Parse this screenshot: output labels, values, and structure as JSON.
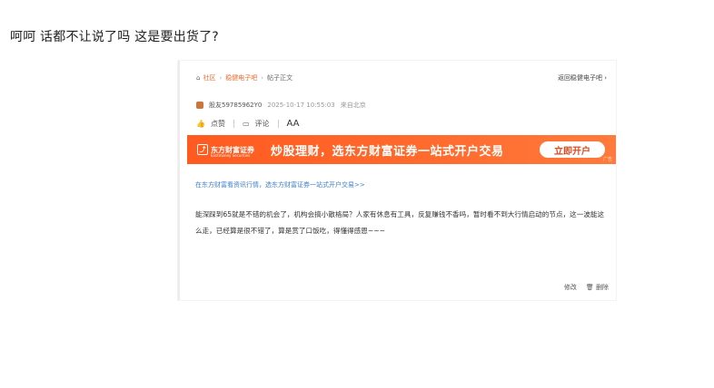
{
  "post": {
    "text": "呵呵 话都不让说了吗 这是要出货了?"
  },
  "screenshot": {
    "breadcrumb": {
      "home": "社区",
      "forum": "稳健电子吧",
      "current": "帖子正文"
    },
    "back_link": "返回稳健电子吧",
    "author": {
      "name": "股友59785962Y0",
      "timestamp": "2025-10-17 10:55:03",
      "location": "来自北京"
    },
    "actions": {
      "like": "点赞",
      "comment": "评论",
      "font": "AA"
    },
    "banner": {
      "logo": "东方财富证券",
      "logo_sub": "Eastmoney Securities",
      "slogan": "炒股理财，选东方财富证券一站式开户交易",
      "cta": "立即开户",
      "ad_tag": "广告"
    },
    "promo_link": "在东方财富看资讯行情，选东方财富证券一站式开户交易>>",
    "body": "能深踩到65就是不错的机会了，机构会搞小散格局？人家有休息有工具，反复赚钱不香吗，暂时看不到大行情启动的节点，这一波能这么走，已经算是很不错了，算是赏了口饭吃，得懂得感恩~~~",
    "ops": {
      "edit": "修改",
      "delete": "删除"
    }
  }
}
